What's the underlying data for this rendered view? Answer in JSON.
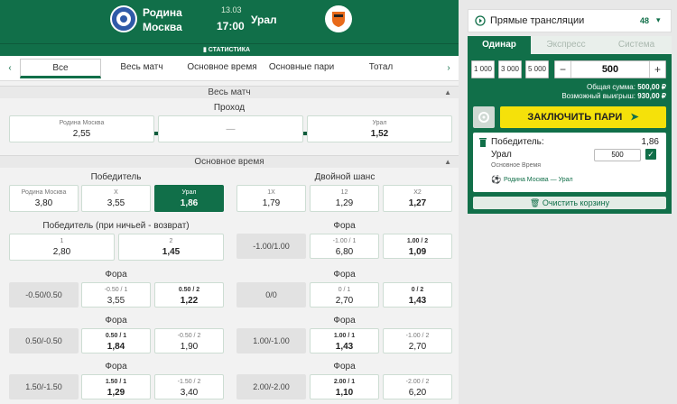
{
  "match": {
    "home_line1": "Родина",
    "home_line2": "Москва",
    "away": "Урал",
    "date": "13.03",
    "time": "17:00",
    "stats_label": "СТАТИСТИКА"
  },
  "tabs": [
    "Все",
    "Весь матч",
    "Основное время",
    "Основные пари",
    "Тотал"
  ],
  "sections": {
    "full_match": "Весь матч",
    "main_time": "Основное время"
  },
  "progress": {
    "title": "Проход",
    "home_label": "Родина Москва",
    "home_odds": "2,55",
    "mid": "—",
    "away_label": "Урал",
    "away_odds": "1,52"
  },
  "winner": {
    "title": "Победитель",
    "items": [
      {
        "label": "Родина Москва",
        "odds": "3,80"
      },
      {
        "label": "X",
        "odds": "3,55"
      },
      {
        "label": "Урал",
        "odds": "1,86"
      }
    ]
  },
  "double_chance": {
    "title": "Двойной шанс",
    "items": [
      {
        "label": "1X",
        "odds": "1,79"
      },
      {
        "label": "12",
        "odds": "1,29"
      },
      {
        "label": "X2",
        "odds": "1,27"
      }
    ]
  },
  "dnb": {
    "title": "Победитель (при ничьей - возврат)",
    "items": [
      {
        "label": "1",
        "odds": "2,80"
      },
      {
        "label": "2",
        "odds": "1,45"
      }
    ]
  },
  "fora_title": "Фора",
  "fora_left": [
    {
      "hcap": "-0.50/0.50",
      "a_label": "-0.50 / 1",
      "a_odds": "3,55",
      "b_label": "0.50 / 2",
      "b_odds": "1,22"
    },
    {
      "hcap": "0.50/-0.50",
      "a_label": "0.50 / 1",
      "a_odds": "1,84",
      "b_label": "-0.50 / 2",
      "b_odds": "1,90"
    },
    {
      "hcap": "1.50/-1.50",
      "a_label": "1.50 / 1",
      "a_odds": "1,29",
      "b_label": "-1.50 / 2",
      "b_odds": "3,40"
    }
  ],
  "fora_right": [
    {
      "hcap": "-1.00/1.00",
      "a_label": "-1.00 / 1",
      "a_odds": "6,80",
      "b_label": "1.00 / 2",
      "b_odds": "1,09"
    },
    {
      "hcap": "0/0",
      "a_label": "0 / 1",
      "a_odds": "2,70",
      "b_label": "0 / 2",
      "b_odds": "1,43"
    },
    {
      "hcap": "1.00/-1.00",
      "a_label": "1.00 / 1",
      "a_odds": "1,43",
      "b_label": "-1.00 / 2",
      "b_odds": "2,70"
    },
    {
      "hcap": "2.00/-2.00",
      "a_label": "2.00 / 1",
      "a_odds": "1,10",
      "b_label": "-2.00 / 2",
      "b_odds": "6,20"
    }
  ],
  "live": {
    "label": "Прямые трансляции",
    "count": "48"
  },
  "slip": {
    "tabs": [
      "Одинар",
      "Экспресс",
      "Система"
    ],
    "amounts": [
      "1 000",
      "3 000",
      "5 000"
    ],
    "minus": "−",
    "plus": "+",
    "stake": "500",
    "total_label": "Общая сумма:",
    "total": "500,00 ₽",
    "win_label": "Возможный выигрыш:",
    "win": "930,00 ₽",
    "place": "ЗАКЛЮЧИТЬ ПАРИ",
    "bet_market": "Победитель:",
    "bet_odds": "1,86",
    "bet_pick": "Урал",
    "bet_amount": "500",
    "bet_period": "Основное Время",
    "bet_match": "Родина Москва — Урал",
    "clear": "Очистить корзину"
  },
  "colors": {
    "brand": "#116f49",
    "accent": "#f5e10a"
  }
}
